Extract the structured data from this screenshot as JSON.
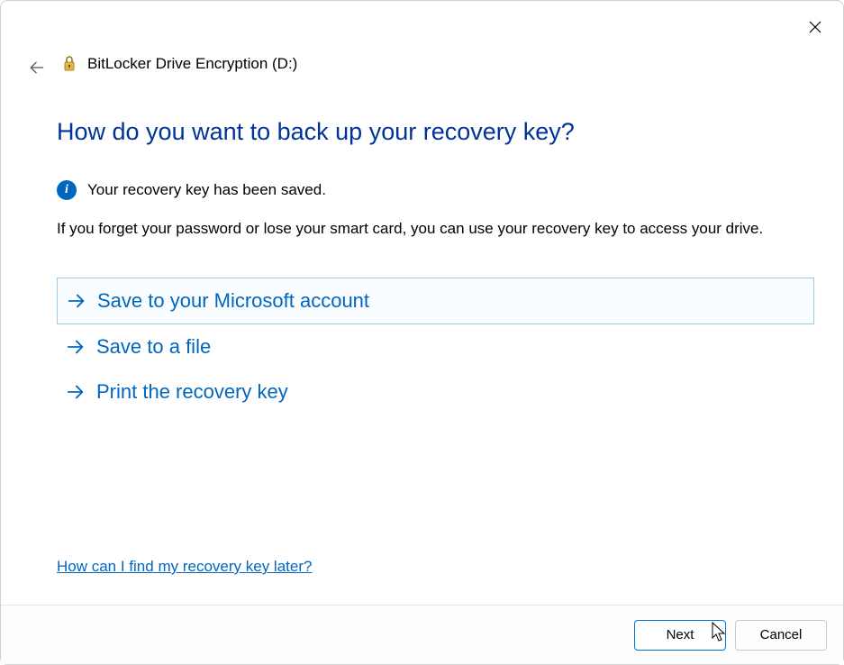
{
  "window": {
    "title": "BitLocker Drive Encryption (D:)"
  },
  "heading": "How do you want to back up your recovery key?",
  "info": {
    "text": "Your recovery key has been saved."
  },
  "description": "If you forget your password or lose your smart card, you can use your recovery key to access your drive.",
  "options": [
    {
      "label": "Save to your Microsoft account",
      "selected": true
    },
    {
      "label": "Save to a file",
      "selected": false
    },
    {
      "label": "Print the recovery key",
      "selected": false
    }
  ],
  "help_link": "How can I find my recovery key later?",
  "buttons": {
    "next": "Next",
    "cancel": "Cancel"
  }
}
